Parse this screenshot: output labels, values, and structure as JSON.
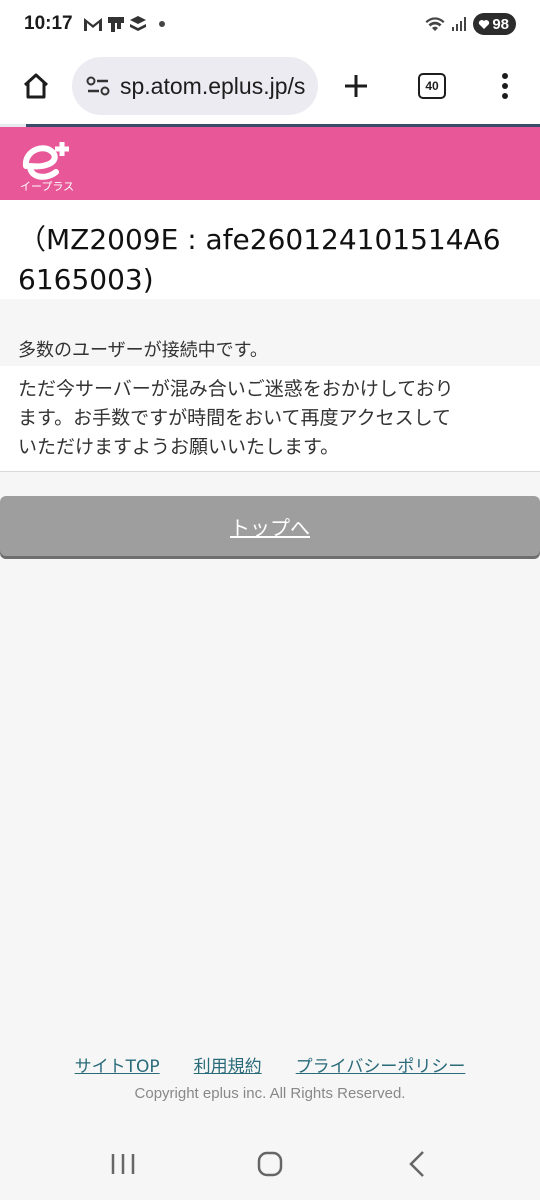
{
  "status_bar": {
    "time": "10:17",
    "battery": "98",
    "icons": [
      "gmail-icon",
      "notification-icon",
      "layers-icon",
      "wifi-icon",
      "signal-icon",
      "battery-icon"
    ]
  },
  "browser": {
    "url": "sp.atom.eplus.jp/s",
    "tab_count": "40",
    "icons": [
      "home-icon",
      "site-settings-icon",
      "new-tab-icon",
      "tabs-icon",
      "more-icon"
    ]
  },
  "site": {
    "logo_text": "イープラス",
    "brand_color": "#e85898"
  },
  "error": {
    "code": "（MZ2009E : afe260124101514A6",
    "code_line2": "6165003)",
    "title": "多数のユーザーが接続中です。",
    "body_line1": "ただ今サーバーが混み合いご迷惑をおかけしており",
    "body_line2": "ます。お手数ですが時間をおいて再度アクセスして",
    "body_line3": "いただけますようお願いいたします。"
  },
  "top_button": {
    "label": "トップへ"
  },
  "footer": {
    "links": [
      "サイトTOP",
      "利用規約",
      "プライバシーポリシー"
    ],
    "copyright": "Copyright eplus inc. All Rights Reserved."
  },
  "nav": {
    "icons": [
      "recent-apps-icon",
      "home-button-icon",
      "back-icon"
    ]
  }
}
